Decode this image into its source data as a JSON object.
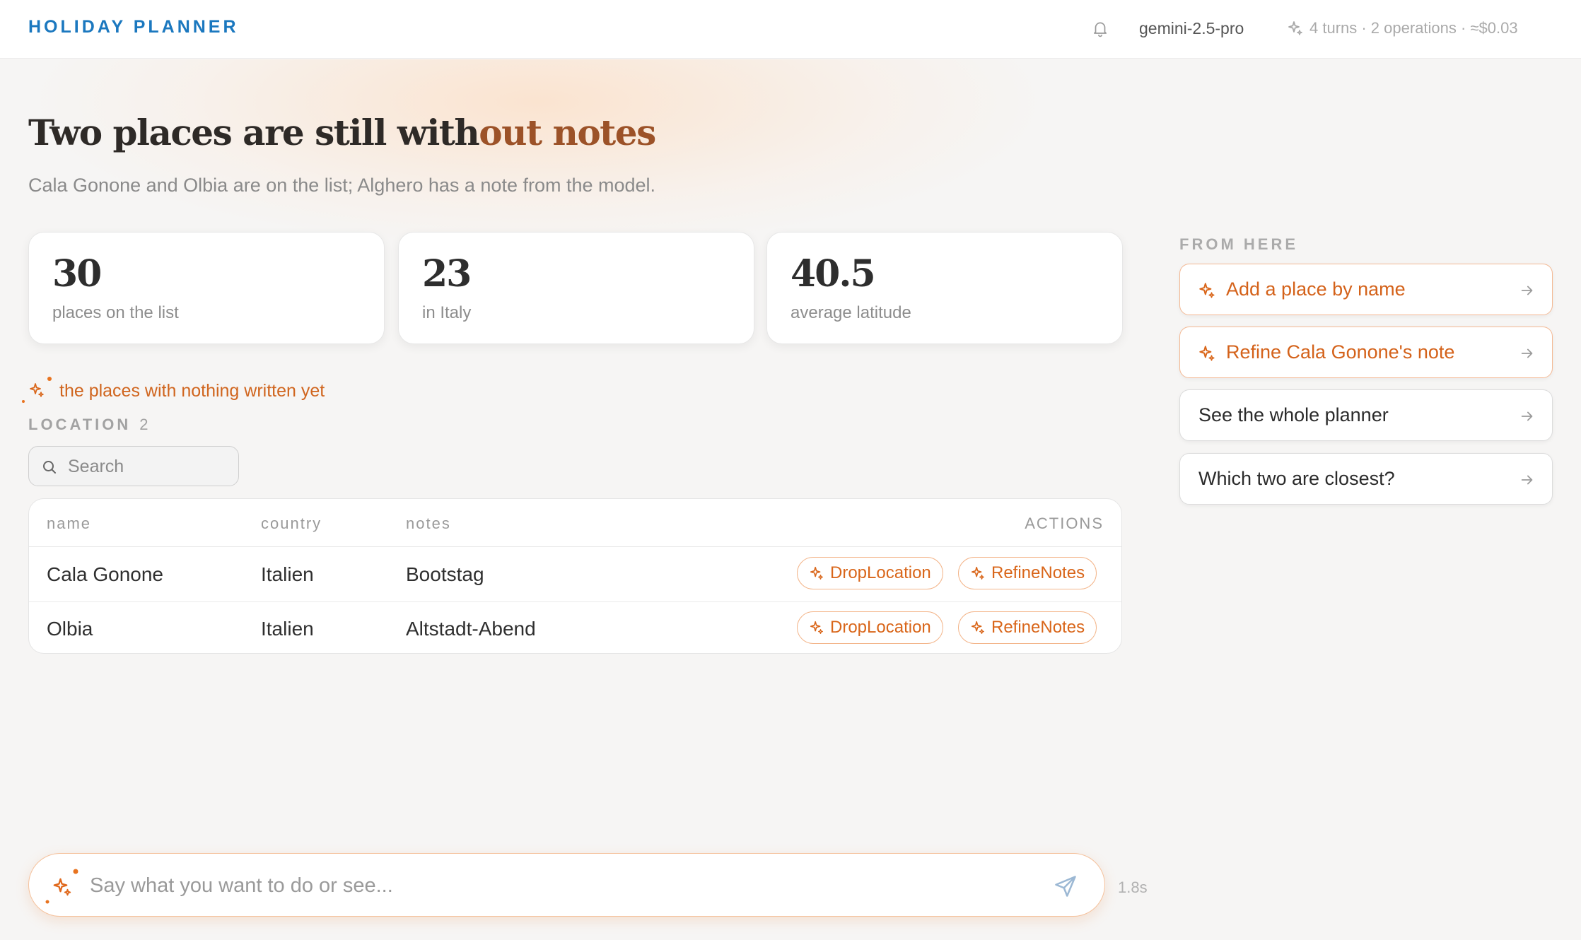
{
  "header": {
    "brand": "HOLIDAY PLANNER",
    "model": "gemini-2.5-pro",
    "usage": "4 turns · 2 operations · ≈$0.03"
  },
  "hero": {
    "title_part1": "Two places are still with",
    "title_part2": "out notes",
    "subtitle": "Cala Gonone and Olbia are on the list; Alghero has a note from the model."
  },
  "stats": [
    {
      "value": "30",
      "label": "places on the list"
    },
    {
      "value": "23",
      "label": "in Italy"
    },
    {
      "value": "40.5",
      "label": "average latitude"
    }
  ],
  "filter": {
    "label": "the places with nothing written yet"
  },
  "location": {
    "label": "LOCATION",
    "count": "2",
    "search_placeholder": "Search"
  },
  "table": {
    "columns": {
      "name": "name",
      "country": "country",
      "notes": "notes",
      "actions": "ACTIONS"
    },
    "rows": [
      {
        "name": "Cala Gonone",
        "country": "Italien",
        "notes": "Bootstag",
        "action1": "DropLocation",
        "action2": "RefineNotes"
      },
      {
        "name": "Olbia",
        "country": "Italien",
        "notes": "Altstadt-Abend",
        "action1": "DropLocation",
        "action2": "RefineNotes"
      }
    ]
  },
  "suggestions": {
    "heading": "FROM HERE",
    "items": [
      {
        "label": "Add a place by name",
        "kind": "ai"
      },
      {
        "label": "Refine Cala Gonone's note",
        "kind": "ai"
      },
      {
        "label": "See the whole planner",
        "kind": "plain"
      },
      {
        "label": "Which two are closest?",
        "kind": "plain"
      }
    ]
  },
  "composer": {
    "placeholder": "Say what you want to do or see...",
    "latency": "1.8s"
  },
  "colors": {
    "brand": "#1b78bf",
    "accent": "#d9661a",
    "headline_accent": "#9c5228"
  }
}
